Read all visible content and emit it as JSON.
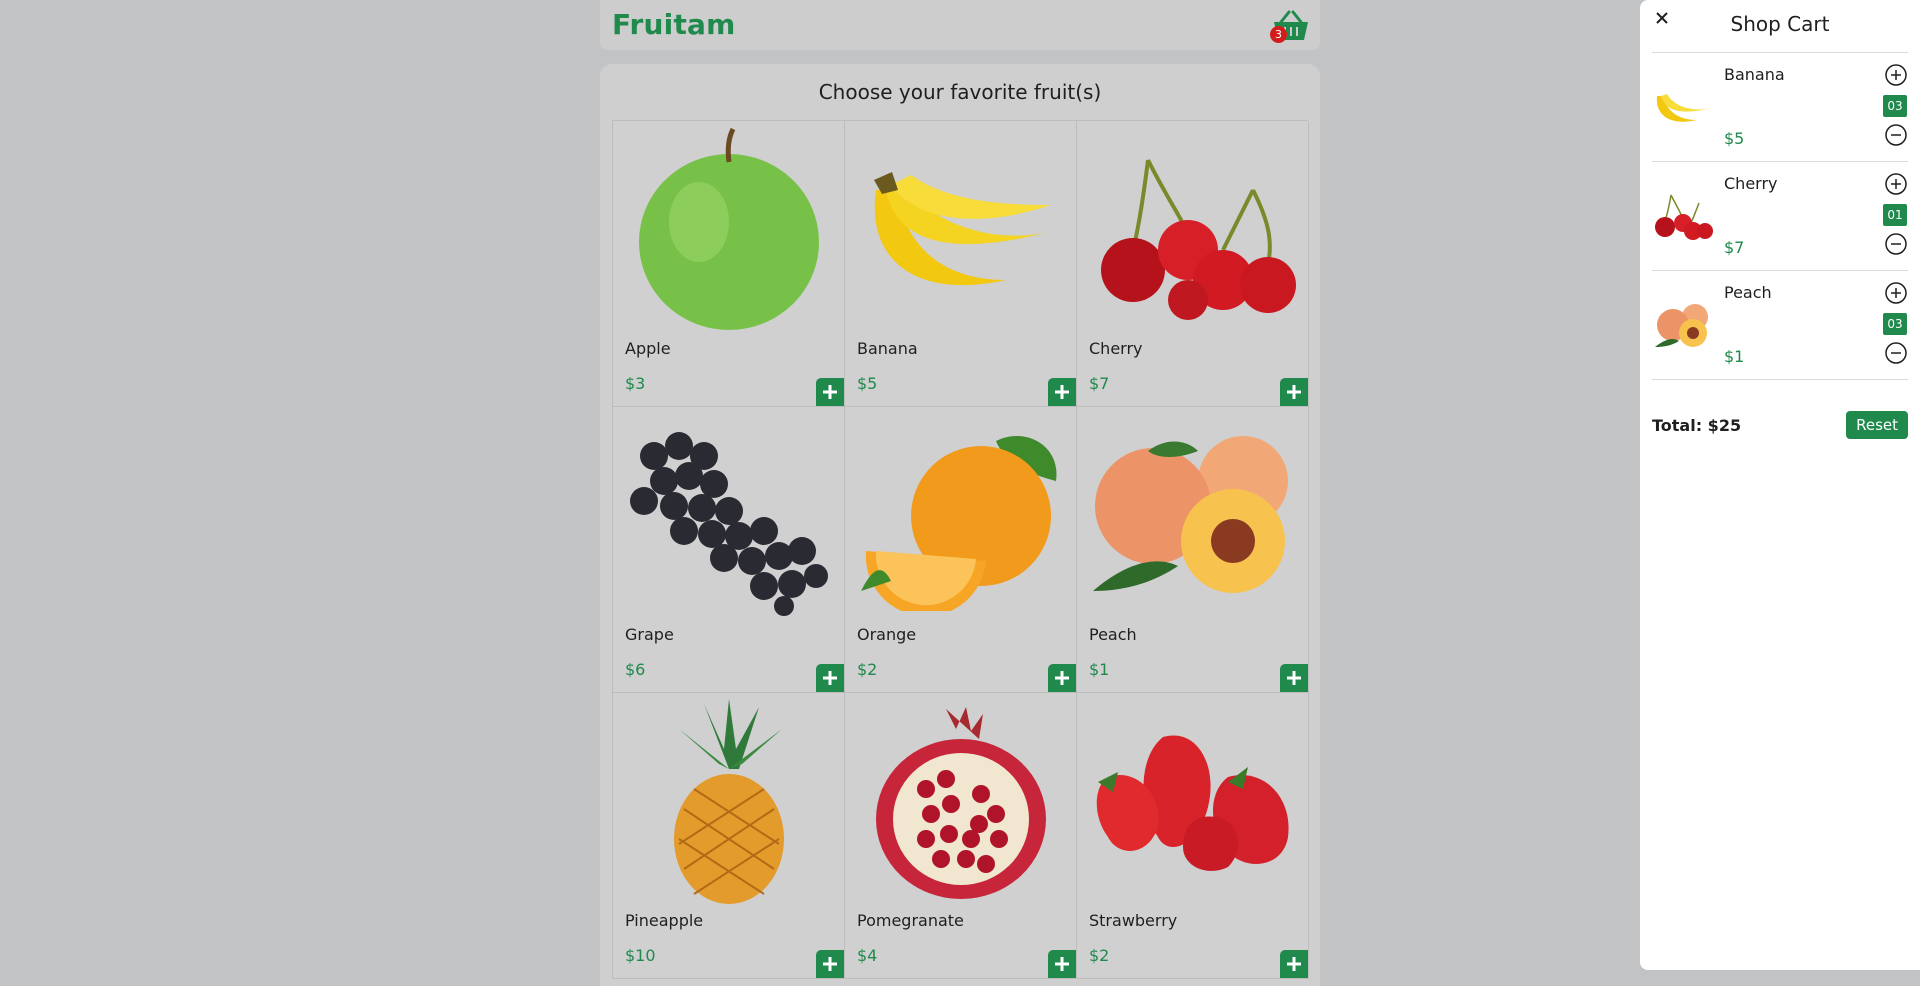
{
  "header": {
    "brand": "Fruitam",
    "cart_icon": "basket-icon",
    "cart_count": "3"
  },
  "main": {
    "title": "Choose your favorite fruit(s)",
    "add_icon": "plus-icon",
    "products": [
      {
        "name": "Apple",
        "price": "$3",
        "image": "apple"
      },
      {
        "name": "Banana",
        "price": "$5",
        "image": "banana"
      },
      {
        "name": "Cherry",
        "price": "$7",
        "image": "cherry"
      },
      {
        "name": "Grape",
        "price": "$6",
        "image": "grape"
      },
      {
        "name": "Orange",
        "price": "$2",
        "image": "orange"
      },
      {
        "name": "Peach",
        "price": "$1",
        "image": "peach"
      },
      {
        "name": "Pineapple",
        "price": "$10",
        "image": "pineapple"
      },
      {
        "name": "Pomegranate",
        "price": "$4",
        "image": "pomegranate"
      },
      {
        "name": "Strawberry",
        "price": "$2",
        "image": "strawberry"
      }
    ]
  },
  "cart": {
    "close_icon": "close-icon",
    "title": "Shop Cart",
    "items": [
      {
        "name": "Banana",
        "price": "$5",
        "qty": "03",
        "image": "banana"
      },
      {
        "name": "Cherry",
        "price": "$7",
        "qty": "01",
        "image": "cherry"
      },
      {
        "name": "Peach",
        "price": "$1",
        "qty": "03",
        "image": "peach"
      }
    ],
    "total": "Total: $25",
    "reset_label": "Reset"
  },
  "colors": {
    "accent": "#1f8a4c",
    "badge": "#d21d1d",
    "overlay_bg": "#c2c3c5"
  }
}
